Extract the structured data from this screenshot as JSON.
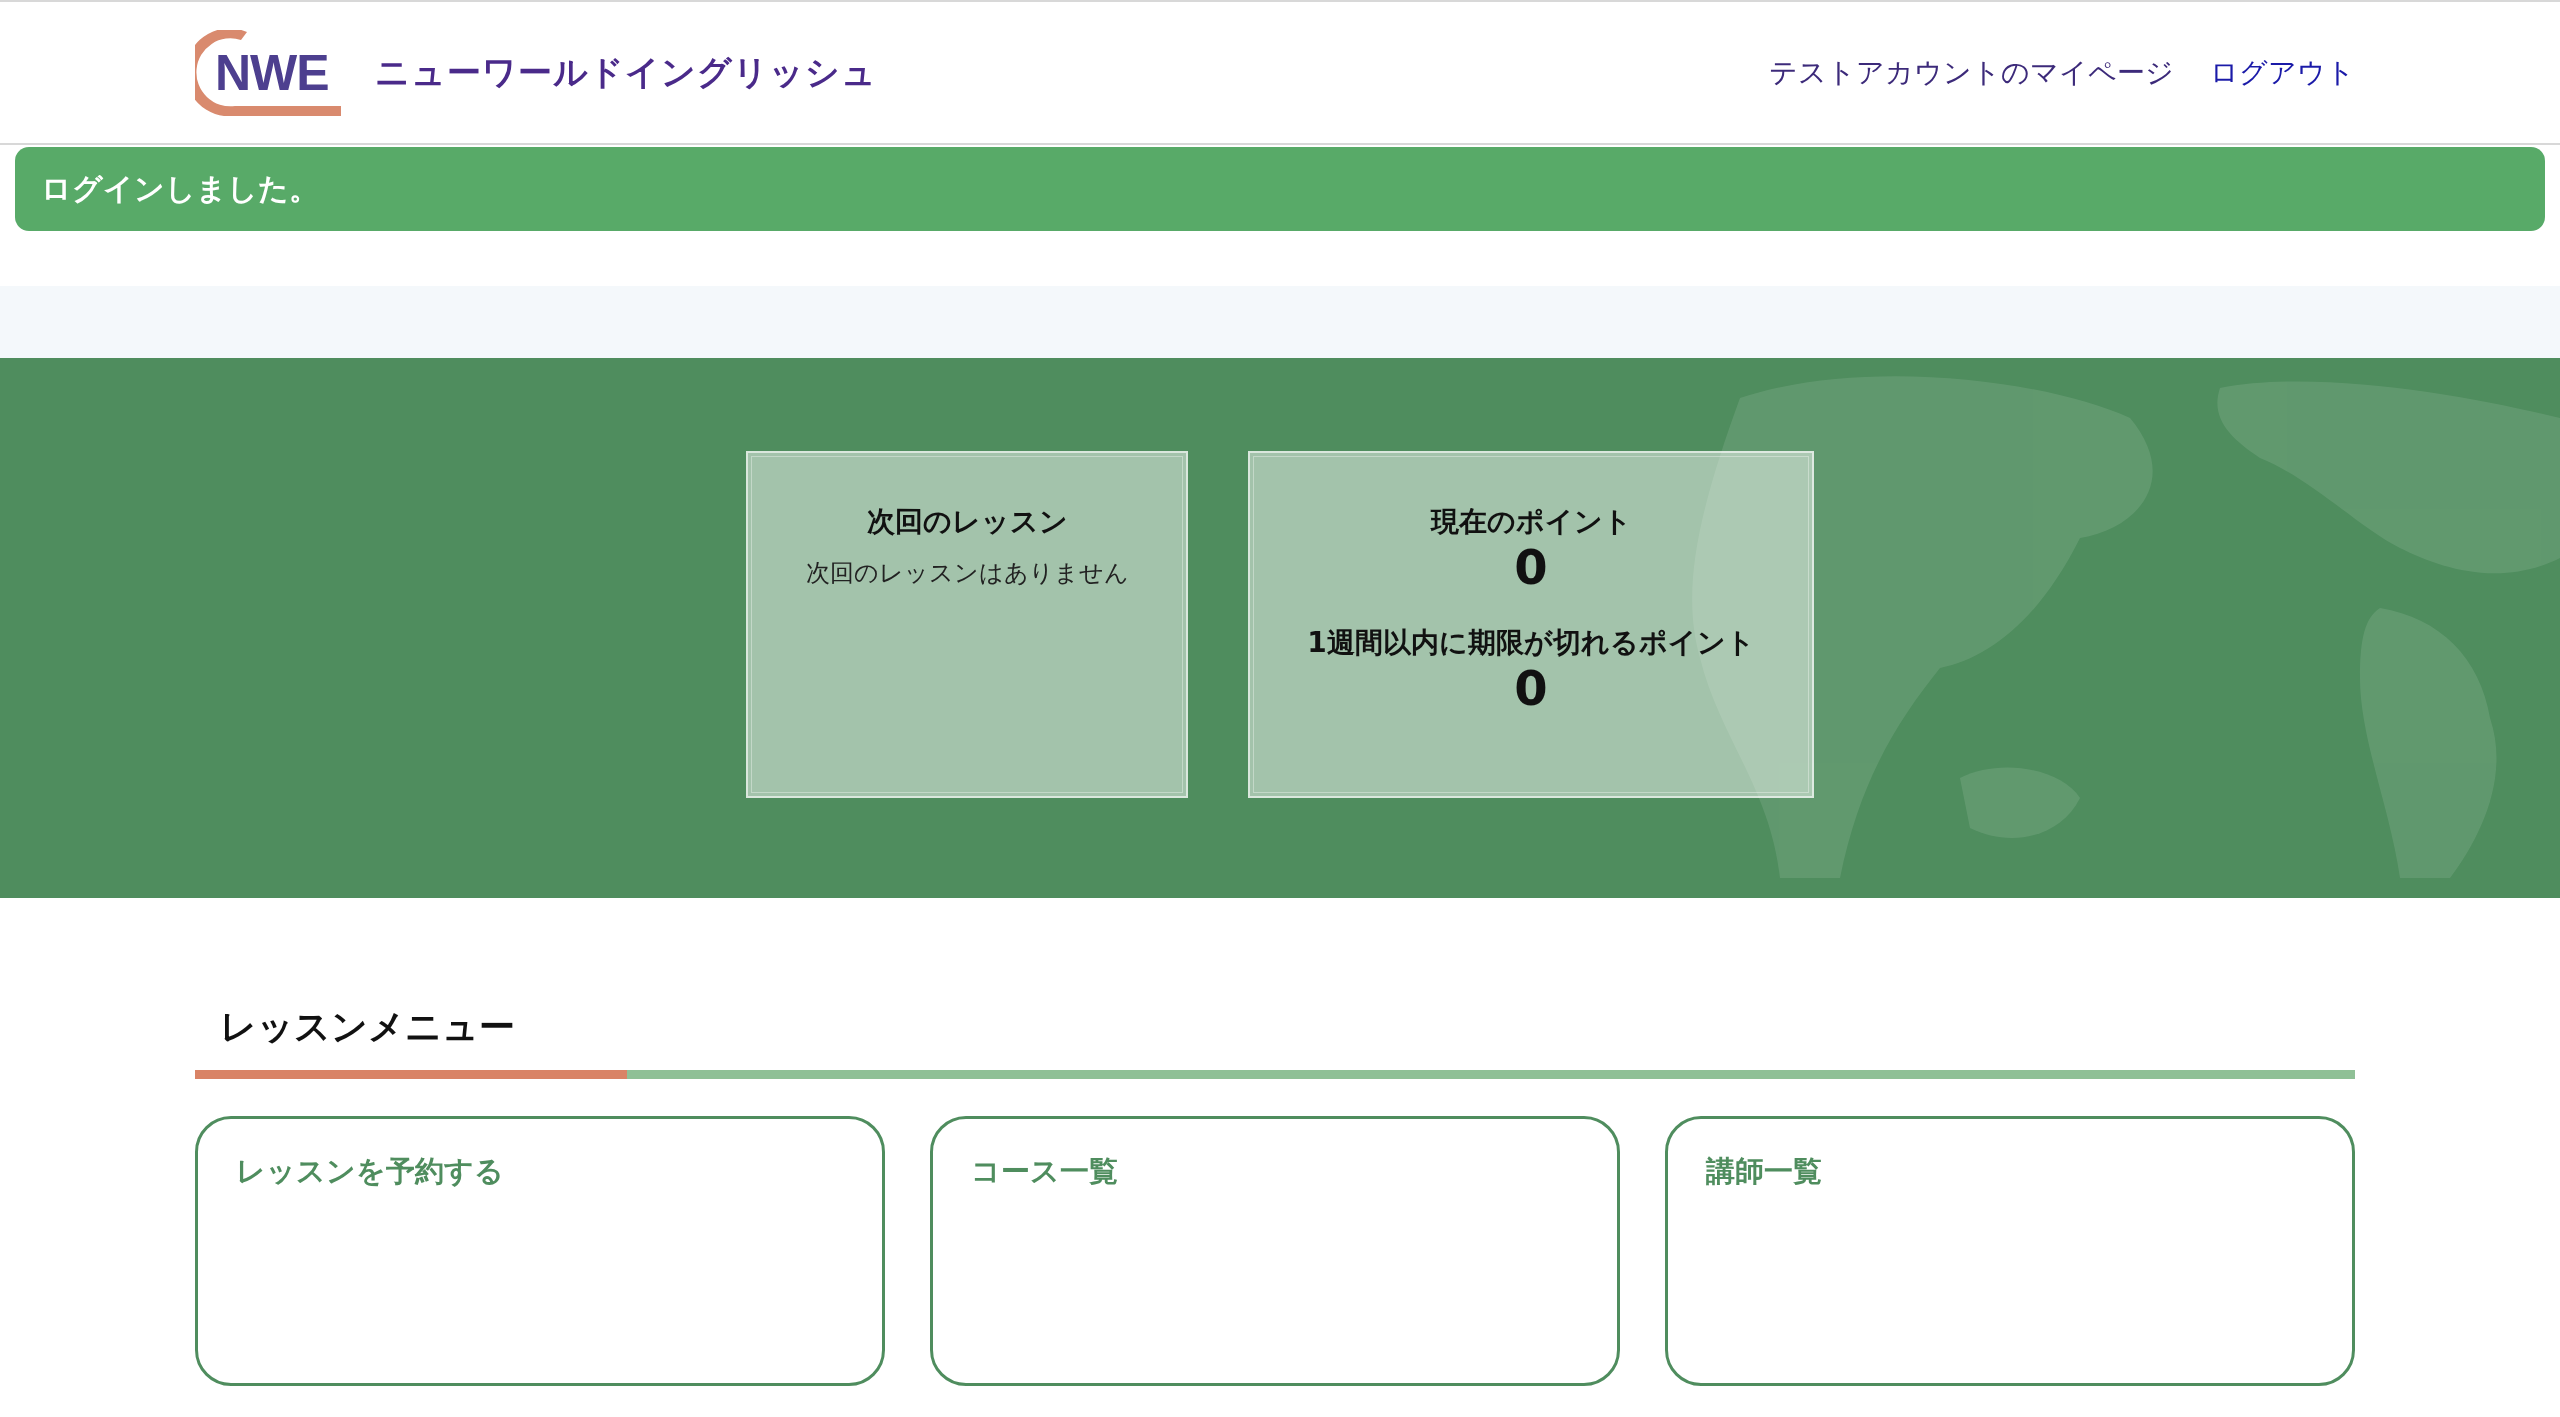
{
  "header": {
    "logo_text": "NWE",
    "site_name": "ニューワールドイングリッシュ",
    "nav": [
      {
        "label": "テストアカウントのマイページ",
        "kind": "plain"
      },
      {
        "label": "ログアウト",
        "kind": "link"
      }
    ]
  },
  "alert": {
    "message": "ログインしました。"
  },
  "summary_cards": [
    {
      "kind": "lesson",
      "title": "次回のレッスン",
      "body": "次回のレッスンはありません"
    },
    {
      "kind": "points",
      "items": [
        {
          "label": "現在のポイント",
          "value": "0"
        },
        {
          "label": "1週間以内に期限が切れるポイント",
          "value": "0"
        }
      ]
    }
  ],
  "lesson_menu": {
    "title": "レッスンメニュー",
    "items": [
      "レッスンを予約する",
      "コース一覧",
      "講師一覧"
    ]
  }
}
